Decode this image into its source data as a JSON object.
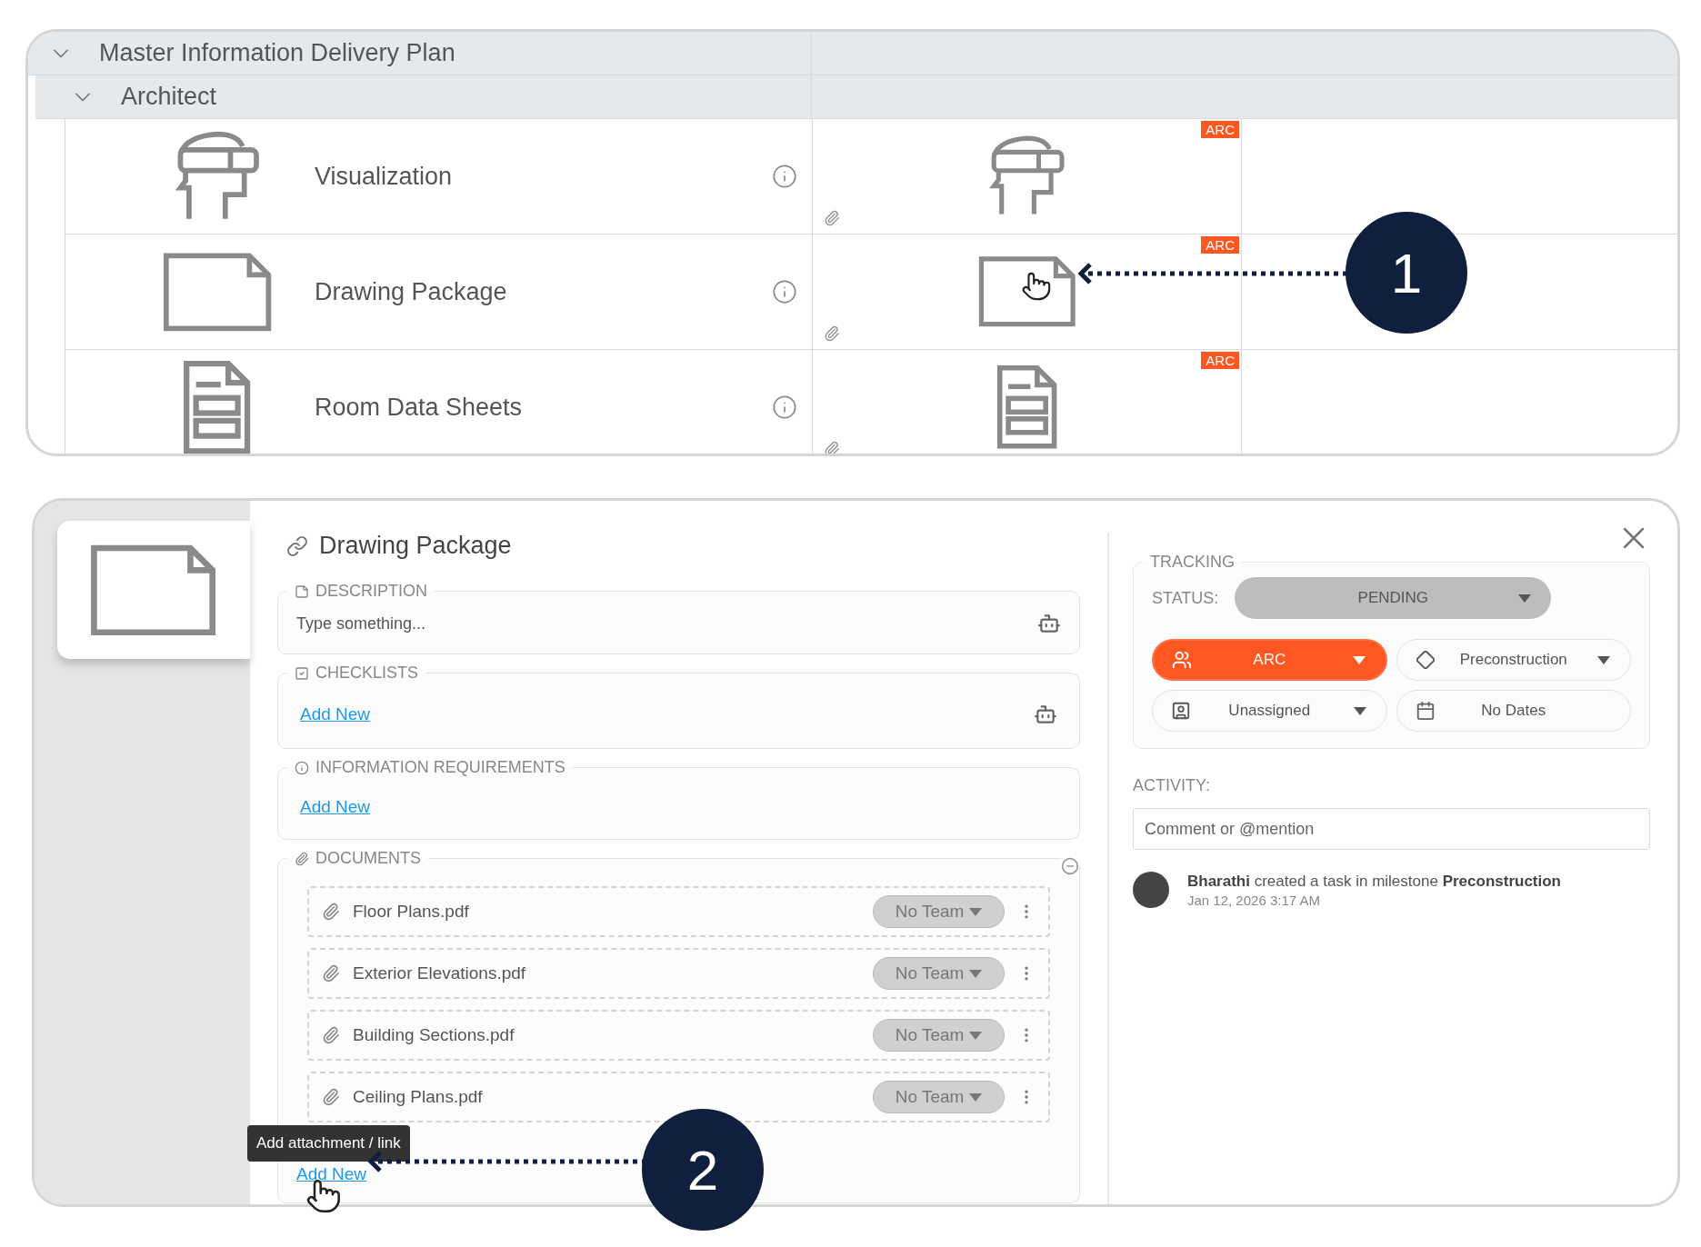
{
  "plan": {
    "title": "Master Information Delivery Plan",
    "expanded": true,
    "group": {
      "title": "Architect",
      "expanded": true
    },
    "rows": [
      {
        "kind": "vr",
        "name": "Visualization",
        "tag": "ARC"
      },
      {
        "kind": "sheet",
        "name": "Drawing Package",
        "tag": "ARC"
      },
      {
        "kind": "datasheet",
        "name": "Room Data Sheets",
        "tag": "ARC"
      }
    ]
  },
  "callouts": [
    "1",
    "2"
  ],
  "task": {
    "title": "Drawing Package",
    "description": {
      "label": "DESCRIPTION",
      "placeholder": "Type something..."
    },
    "checklists": {
      "label": "CHECKLISTS",
      "link": "Add New"
    },
    "requirements": {
      "label": "INFORMATION REQUIREMENTS",
      "link": "Add New"
    },
    "documents": {
      "label": "DOCUMENTS",
      "link": "Add New",
      "tooltip": "Add attachment / link",
      "files": [
        {
          "name": "Floor Plans.pdf",
          "team": "No Team"
        },
        {
          "name": "Exterior Elevations.pdf",
          "team": "No Team"
        },
        {
          "name": "Building Sections.pdf",
          "team": "No Team"
        },
        {
          "name": "Ceiling Plans.pdf",
          "team": "No Team"
        }
      ]
    },
    "tracking": {
      "label": "TRACKING",
      "status_label": "STATUS:",
      "status": "PENDING",
      "team": "ARC",
      "milestone": "Preconstruction",
      "assignee": "Unassigned",
      "dates": "No Dates"
    },
    "activity": {
      "label": "ACTIVITY:",
      "placeholder": "Comment or @mention",
      "entries": [
        {
          "text": "**Bharathi** created a task in milestone **Preconstruction**",
          "time": "Jan 12, 2026 3:17 AM"
        }
      ]
    }
  }
}
